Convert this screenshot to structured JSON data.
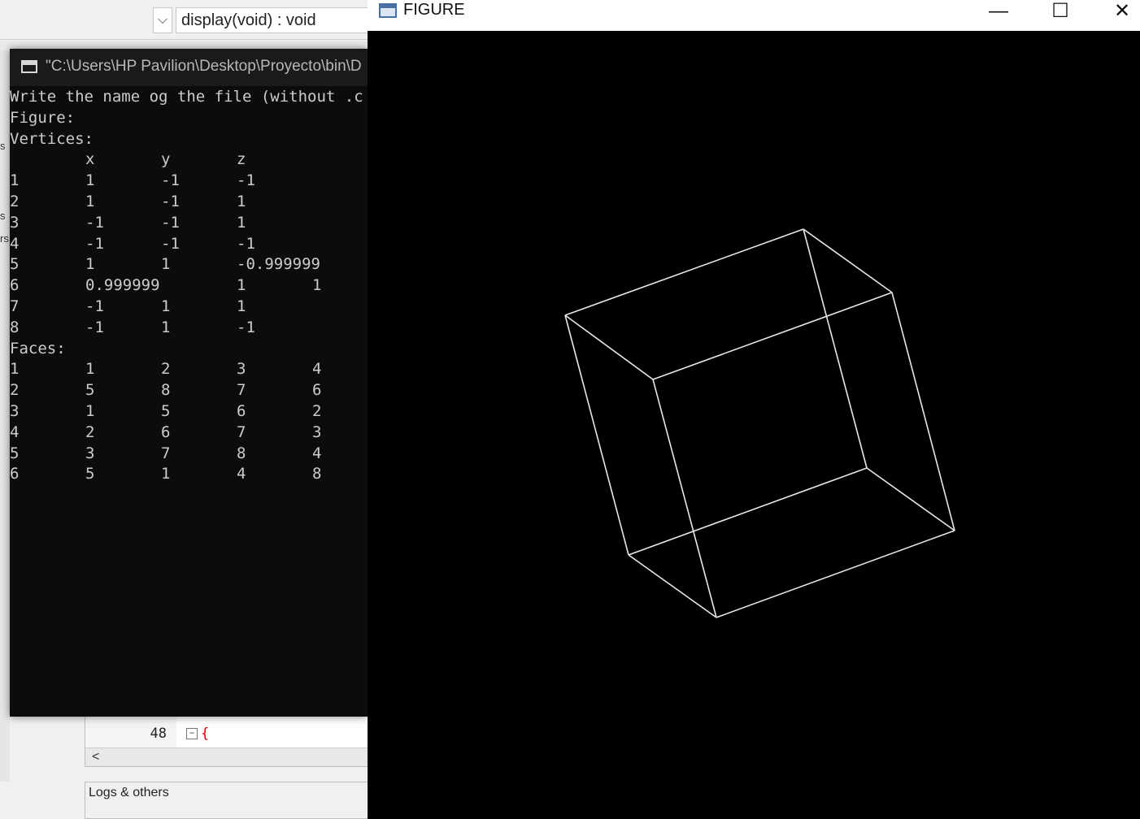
{
  "ide": {
    "function_combo": "display(void) : void",
    "dropdown_arrow": "⌵",
    "left_strip_letters": [
      "s",
      "s",
      "rs"
    ],
    "editor": {
      "line_number": "48",
      "fold_symbol": "−",
      "brace": "{",
      "scroll_left": "<"
    },
    "logs_tab": "Logs & others"
  },
  "console": {
    "title": "\"C:\\Users\\HP Pavilion\\Desktop\\Proyecto\\bin\\D",
    "prompt": "Write the name og the file (without .c",
    "figure_label": "Figure:",
    "vertices_label": "Vertices:",
    "vertex_headers": [
      "x",
      "y",
      "z"
    ],
    "vertices": [
      [
        "1",
        "1",
        "-1",
        "-1"
      ],
      [
        "2",
        "1",
        "-1",
        "1"
      ],
      [
        "3",
        "-1",
        "-1",
        "1"
      ],
      [
        "4",
        "-1",
        "-1",
        "-1"
      ],
      [
        "5",
        "1",
        "1",
        "-0.999999"
      ],
      [
        "6",
        "0.999999",
        "",
        "1",
        "1"
      ],
      [
        "7",
        "-1",
        "1",
        "1"
      ],
      [
        "8",
        "-1",
        "1",
        "-1"
      ]
    ],
    "faces_label": "Faces:",
    "faces": [
      [
        "1",
        "1",
        "2",
        "3",
        "4"
      ],
      [
        "2",
        "5",
        "8",
        "7",
        "6"
      ],
      [
        "3",
        "1",
        "5",
        "6",
        "2"
      ],
      [
        "4",
        "2",
        "6",
        "7",
        "3"
      ],
      [
        "5",
        "3",
        "7",
        "8",
        "4"
      ],
      [
        "6",
        "5",
        "1",
        "4",
        "8"
      ]
    ]
  },
  "figure": {
    "title": "FIGURE",
    "minimize": "—",
    "maximize": "☐",
    "close": "✕",
    "line_color": "#e8e8e8",
    "background_color": "#000000"
  }
}
